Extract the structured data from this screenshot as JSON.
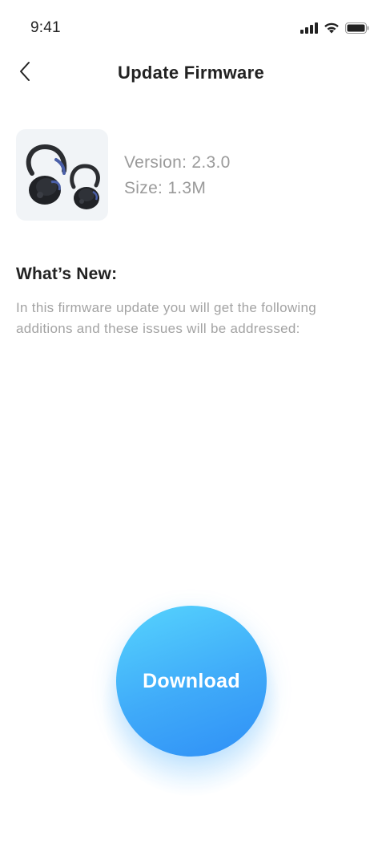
{
  "status_bar": {
    "time": "9:41",
    "icons": [
      "signal-icon",
      "wifi-icon",
      "battery-icon"
    ]
  },
  "header": {
    "title": "Update Firmware",
    "back_icon": "chevron-left-icon"
  },
  "product": {
    "image": "earbuds-image",
    "version": "Version: 2.3.0",
    "size": "Size: 1.3M"
  },
  "whats_new": {
    "heading": "What’s New:",
    "body": "In this firmware update you will get the following additions and these issues will be addressed:"
  },
  "download": {
    "label": "Download"
  },
  "colors": {
    "accent_start": "#56d4fd",
    "accent_end": "#2f8ff6",
    "text_primary": "#222222",
    "text_secondary": "#9a9a9a",
    "thumb_bg": "#f1f4f7"
  }
}
